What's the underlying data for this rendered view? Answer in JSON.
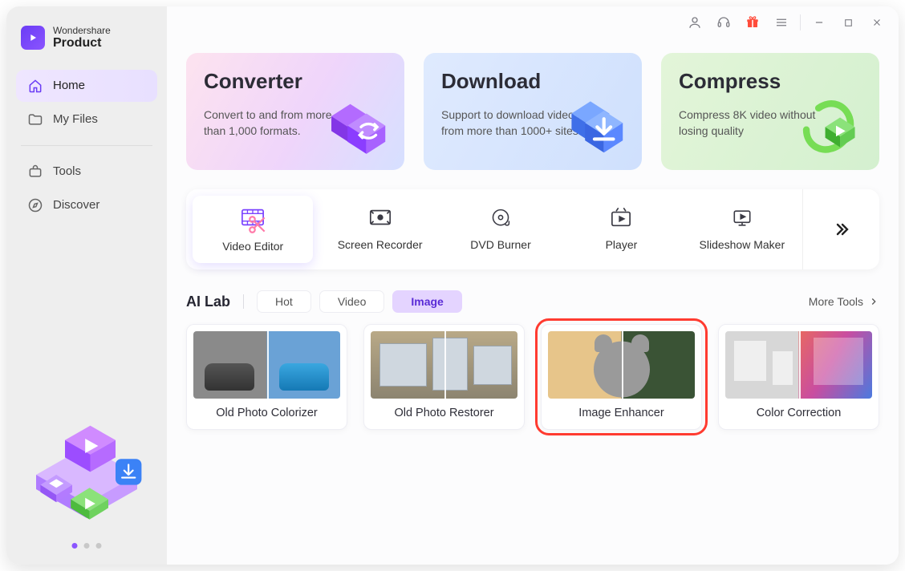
{
  "brand": {
    "top": "Wondershare",
    "bottom": "Product"
  },
  "nav": {
    "home": {
      "label": "Home",
      "active": true
    },
    "files": {
      "label": "My Files",
      "active": false
    },
    "tools": {
      "label": "Tools",
      "active": false
    },
    "discover": {
      "label": "Discover",
      "active": false
    }
  },
  "cards": {
    "converter": {
      "title": "Converter",
      "desc": "Convert to and from more than 1,000 formats."
    },
    "download": {
      "title": "Download",
      "desc": "Support to download videos from more than 1000+ sites."
    },
    "compress": {
      "title": "Compress",
      "desc": "Compress 8K video without losing quality"
    }
  },
  "tools": {
    "video_editor": "Video Editor",
    "screen_recorder": "Screen Recorder",
    "dvd_burner": "DVD Burner",
    "player": "Player",
    "slideshow_maker": "Slideshow Maker"
  },
  "ailab": {
    "title": "AI Lab",
    "pills": {
      "hot": "Hot",
      "video": "Video",
      "image": "Image"
    },
    "active_pill": "image",
    "more": "More Tools",
    "items": {
      "colorizer": "Old Photo Colorizer",
      "restorer": "Old Photo Restorer",
      "enhancer": "Image Enhancer",
      "colorcorr": "Color Correction"
    },
    "highlighted": "enhancer"
  }
}
